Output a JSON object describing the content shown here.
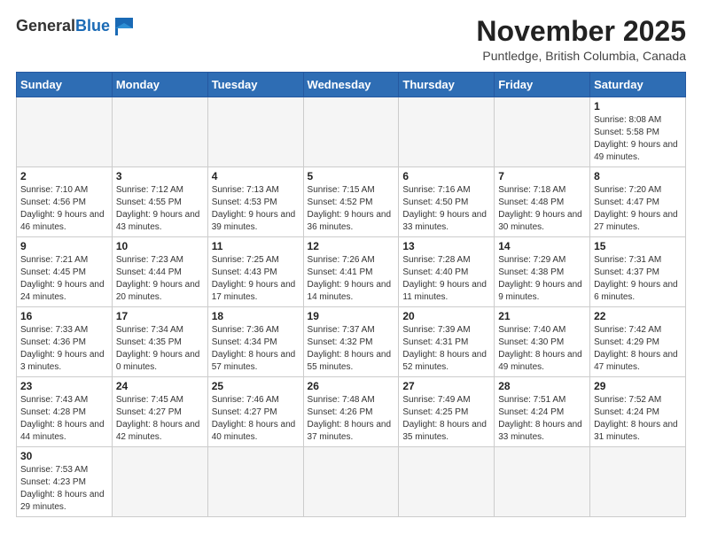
{
  "logo": {
    "general": "General",
    "blue": "Blue"
  },
  "header": {
    "month": "November 2025",
    "location": "Puntledge, British Columbia, Canada"
  },
  "weekdays": [
    "Sunday",
    "Monday",
    "Tuesday",
    "Wednesday",
    "Thursday",
    "Friday",
    "Saturday"
  ],
  "weeks": [
    [
      {
        "day": "",
        "empty": true
      },
      {
        "day": "",
        "empty": true
      },
      {
        "day": "",
        "empty": true
      },
      {
        "day": "",
        "empty": true
      },
      {
        "day": "",
        "empty": true
      },
      {
        "day": "",
        "empty": true
      },
      {
        "day": "1",
        "sunrise": "Sunrise: 8:08 AM",
        "sunset": "Sunset: 5:58 PM",
        "daylight": "Daylight: 9 hours and 49 minutes."
      }
    ],
    [
      {
        "day": "2",
        "sunrise": "Sunrise: 7:10 AM",
        "sunset": "Sunset: 4:56 PM",
        "daylight": "Daylight: 9 hours and 46 minutes."
      },
      {
        "day": "3",
        "sunrise": "Sunrise: 7:12 AM",
        "sunset": "Sunset: 4:55 PM",
        "daylight": "Daylight: 9 hours and 43 minutes."
      },
      {
        "day": "4",
        "sunrise": "Sunrise: 7:13 AM",
        "sunset": "Sunset: 4:53 PM",
        "daylight": "Daylight: 9 hours and 39 minutes."
      },
      {
        "day": "5",
        "sunrise": "Sunrise: 7:15 AM",
        "sunset": "Sunset: 4:52 PM",
        "daylight": "Daylight: 9 hours and 36 minutes."
      },
      {
        "day": "6",
        "sunrise": "Sunrise: 7:16 AM",
        "sunset": "Sunset: 4:50 PM",
        "daylight": "Daylight: 9 hours and 33 minutes."
      },
      {
        "day": "7",
        "sunrise": "Sunrise: 7:18 AM",
        "sunset": "Sunset: 4:48 PM",
        "daylight": "Daylight: 9 hours and 30 minutes."
      },
      {
        "day": "8",
        "sunrise": "Sunrise: 7:20 AM",
        "sunset": "Sunset: 4:47 PM",
        "daylight": "Daylight: 9 hours and 27 minutes."
      }
    ],
    [
      {
        "day": "9",
        "sunrise": "Sunrise: 7:21 AM",
        "sunset": "Sunset: 4:45 PM",
        "daylight": "Daylight: 9 hours and 24 minutes."
      },
      {
        "day": "10",
        "sunrise": "Sunrise: 7:23 AM",
        "sunset": "Sunset: 4:44 PM",
        "daylight": "Daylight: 9 hours and 20 minutes."
      },
      {
        "day": "11",
        "sunrise": "Sunrise: 7:25 AM",
        "sunset": "Sunset: 4:43 PM",
        "daylight": "Daylight: 9 hours and 17 minutes."
      },
      {
        "day": "12",
        "sunrise": "Sunrise: 7:26 AM",
        "sunset": "Sunset: 4:41 PM",
        "daylight": "Daylight: 9 hours and 14 minutes."
      },
      {
        "day": "13",
        "sunrise": "Sunrise: 7:28 AM",
        "sunset": "Sunset: 4:40 PM",
        "daylight": "Daylight: 9 hours and 11 minutes."
      },
      {
        "day": "14",
        "sunrise": "Sunrise: 7:29 AM",
        "sunset": "Sunset: 4:38 PM",
        "daylight": "Daylight: 9 hours and 9 minutes."
      },
      {
        "day": "15",
        "sunrise": "Sunrise: 7:31 AM",
        "sunset": "Sunset: 4:37 PM",
        "daylight": "Daylight: 9 hours and 6 minutes."
      }
    ],
    [
      {
        "day": "16",
        "sunrise": "Sunrise: 7:33 AM",
        "sunset": "Sunset: 4:36 PM",
        "daylight": "Daylight: 9 hours and 3 minutes."
      },
      {
        "day": "17",
        "sunrise": "Sunrise: 7:34 AM",
        "sunset": "Sunset: 4:35 PM",
        "daylight": "Daylight: 9 hours and 0 minutes."
      },
      {
        "day": "18",
        "sunrise": "Sunrise: 7:36 AM",
        "sunset": "Sunset: 4:34 PM",
        "daylight": "Daylight: 8 hours and 57 minutes."
      },
      {
        "day": "19",
        "sunrise": "Sunrise: 7:37 AM",
        "sunset": "Sunset: 4:32 PM",
        "daylight": "Daylight: 8 hours and 55 minutes."
      },
      {
        "day": "20",
        "sunrise": "Sunrise: 7:39 AM",
        "sunset": "Sunset: 4:31 PM",
        "daylight": "Daylight: 8 hours and 52 minutes."
      },
      {
        "day": "21",
        "sunrise": "Sunrise: 7:40 AM",
        "sunset": "Sunset: 4:30 PM",
        "daylight": "Daylight: 8 hours and 49 minutes."
      },
      {
        "day": "22",
        "sunrise": "Sunrise: 7:42 AM",
        "sunset": "Sunset: 4:29 PM",
        "daylight": "Daylight: 8 hours and 47 minutes."
      }
    ],
    [
      {
        "day": "23",
        "sunrise": "Sunrise: 7:43 AM",
        "sunset": "Sunset: 4:28 PM",
        "daylight": "Daylight: 8 hours and 44 minutes."
      },
      {
        "day": "24",
        "sunrise": "Sunrise: 7:45 AM",
        "sunset": "Sunset: 4:27 PM",
        "daylight": "Daylight: 8 hours and 42 minutes."
      },
      {
        "day": "25",
        "sunrise": "Sunrise: 7:46 AM",
        "sunset": "Sunset: 4:27 PM",
        "daylight": "Daylight: 8 hours and 40 minutes."
      },
      {
        "day": "26",
        "sunrise": "Sunrise: 7:48 AM",
        "sunset": "Sunset: 4:26 PM",
        "daylight": "Daylight: 8 hours and 37 minutes."
      },
      {
        "day": "27",
        "sunrise": "Sunrise: 7:49 AM",
        "sunset": "Sunset: 4:25 PM",
        "daylight": "Daylight: 8 hours and 35 minutes."
      },
      {
        "day": "28",
        "sunrise": "Sunrise: 7:51 AM",
        "sunset": "Sunset: 4:24 PM",
        "daylight": "Daylight: 8 hours and 33 minutes."
      },
      {
        "day": "29",
        "sunrise": "Sunrise: 7:52 AM",
        "sunset": "Sunset: 4:24 PM",
        "daylight": "Daylight: 8 hours and 31 minutes."
      }
    ],
    [
      {
        "day": "30",
        "sunrise": "Sunrise: 7:53 AM",
        "sunset": "Sunset: 4:23 PM",
        "daylight": "Daylight: 8 hours and 29 minutes."
      },
      {
        "day": "",
        "empty": true
      },
      {
        "day": "",
        "empty": true
      },
      {
        "day": "",
        "empty": true
      },
      {
        "day": "",
        "empty": true
      },
      {
        "day": "",
        "empty": true
      },
      {
        "day": "",
        "empty": true
      }
    ]
  ]
}
